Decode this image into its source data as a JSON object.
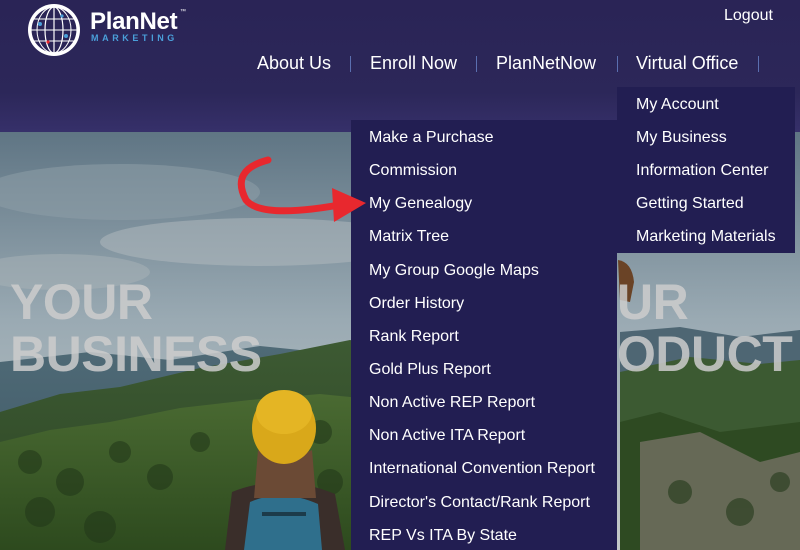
{
  "header": {
    "logo_name": "PlanNet",
    "logo_tm": "™",
    "logo_tagline": "MARKETING",
    "logout_label": "Logout",
    "nav": [
      {
        "label": "About Us"
      },
      {
        "label": "Enroll Now"
      },
      {
        "label": "PlanNetNow"
      },
      {
        "label": "Virtual Office"
      }
    ]
  },
  "hero": {
    "left_text_line1": "YOUR",
    "left_text_line2": "BUSINESS",
    "right_text_line1": "UR",
    "right_text_line2": "ODUCT"
  },
  "virtual_office_menu": [
    {
      "label": "My Account"
    },
    {
      "label": "My Business"
    },
    {
      "label": "Information Center"
    },
    {
      "label": "Getting Started"
    },
    {
      "label": "Marketing Materials"
    }
  ],
  "my_business_menu": [
    {
      "label": "Make a Purchase"
    },
    {
      "label": "Commission"
    },
    {
      "label": "My Genealogy"
    },
    {
      "label": "Matrix Tree"
    },
    {
      "label": "My Group Google Maps"
    },
    {
      "label": "Order History"
    },
    {
      "label": "Rank Report"
    },
    {
      "label": "Gold Plus Report"
    },
    {
      "label": "Non Active REP Report"
    },
    {
      "label": "Non Active ITA Report"
    },
    {
      "label": "International Convention Report"
    },
    {
      "label": "Director's Contact/Rank Report"
    },
    {
      "label": "REP Vs ITA By State"
    }
  ],
  "annotation": {
    "arrow_color": "#e8282e",
    "target": "My Genealogy"
  }
}
